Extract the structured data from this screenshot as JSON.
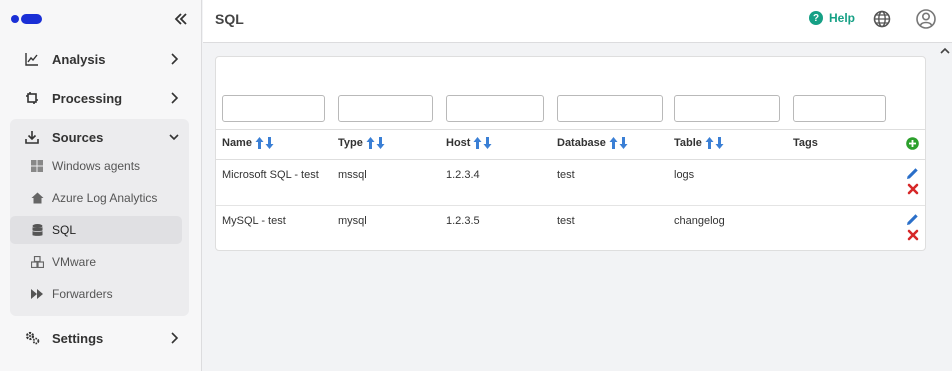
{
  "sidebar": {
    "items": [
      {
        "label": "Analysis",
        "icon": "chart-line-icon"
      },
      {
        "label": "Processing",
        "icon": "gear-cycle-icon"
      },
      {
        "label": "Sources",
        "icon": "download-icon"
      },
      {
        "label": "Settings",
        "icon": "gears-icon"
      }
    ],
    "sources_children": [
      {
        "label": "Windows agents",
        "icon": "windows-icon"
      },
      {
        "label": "Azure Log Analytics",
        "icon": "home-icon"
      },
      {
        "label": "SQL",
        "icon": "database-icon"
      },
      {
        "label": "VMware",
        "icon": "cubes-icon"
      },
      {
        "label": "Forwarders",
        "icon": "forward-icon"
      }
    ]
  },
  "header": {
    "title": "SQL",
    "help_label": "Help",
    "help_icon": "?"
  },
  "table": {
    "columns": [
      "Name",
      "Type",
      "Host",
      "Database",
      "Table",
      "Tags"
    ],
    "rows": [
      {
        "name": "Microsoft SQL - test",
        "type": "mssql",
        "host": "1.2.3.4",
        "database": "test",
        "table": "logs",
        "tags": ""
      },
      {
        "name": "MySQL - test",
        "type": "mysql",
        "host": "1.2.3.5",
        "database": "test",
        "table": "changelog",
        "tags": ""
      }
    ]
  },
  "colors": {
    "brand": "#1a2fd6",
    "help_accent": "#16a085",
    "sort_arrow": "#3a7fd5",
    "add": "#2ca02c",
    "delete": "#d62728",
    "edit": "#2a6fc9"
  }
}
